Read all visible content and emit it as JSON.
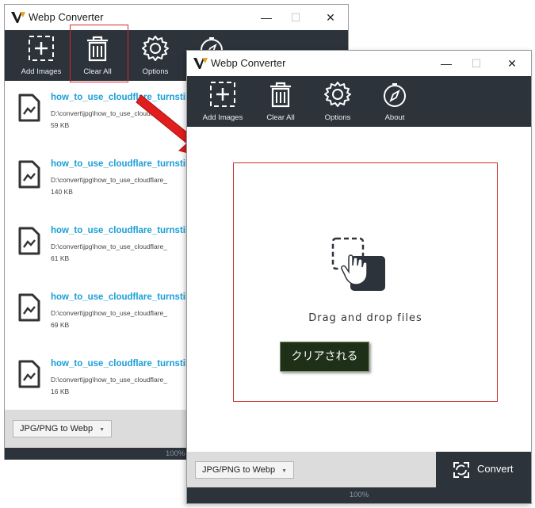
{
  "back_window": {
    "title": "Webp Converter",
    "toolbar": [
      {
        "label": "Add Images",
        "icon": "add-images-icon"
      },
      {
        "label": "Clear All",
        "icon": "trash-icon"
      },
      {
        "label": "Options",
        "icon": "gear-icon"
      },
      {
        "label": "",
        "icon": "compass-icon"
      }
    ],
    "files": [
      {
        "name": "how_to_use_cloudflare_turnstil",
        "path": "D:\\convert\\jpg\\how_to_use_cloudflare_",
        "size": "59 KB"
      },
      {
        "name": "how_to_use_cloudflare_turnstil",
        "path": "D:\\convert\\jpg\\how_to_use_cloudflare_",
        "size": "140 KB"
      },
      {
        "name": "how_to_use_cloudflare_turnstil",
        "path": "D:\\convert\\jpg\\how_to_use_cloudflare_",
        "size": "61 KB"
      },
      {
        "name": "how_to_use_cloudflare_turnstil",
        "path": "D:\\convert\\jpg\\how_to_use_cloudflare_",
        "size": "69 KB"
      },
      {
        "name": "how_to_use_cloudflare_turnstil",
        "path": "D:\\convert\\jpg\\how_to_use_cloudflare_",
        "size": "16 KB"
      }
    ],
    "format_select": "JPG/PNG to Webp",
    "status": "100%"
  },
  "front_window": {
    "title": "Webp Converter",
    "toolbar": [
      {
        "label": "Add Images",
        "icon": "add-images-icon"
      },
      {
        "label": "Clear All",
        "icon": "trash-icon"
      },
      {
        "label": "Options",
        "icon": "gear-icon"
      },
      {
        "label": "About",
        "icon": "compass-icon"
      }
    ],
    "drop_text": "Drag and drop files",
    "format_select": "JPG/PNG to Webp",
    "convert_label": "Convert",
    "status": "100%"
  },
  "annotation": {
    "callout_text": "クリアされる",
    "highlight_color": "#d42b2b",
    "arrow_color": "#e01e1e"
  },
  "colors": {
    "toolbar_bg": "#2c333b",
    "link_blue": "#1a9fd8"
  }
}
